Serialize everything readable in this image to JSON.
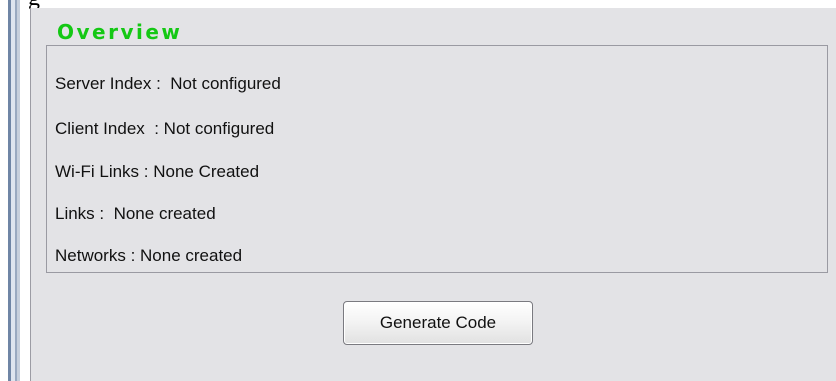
{
  "top_fragment": "g",
  "overview": {
    "title": "Overview",
    "lines": [
      "Server Index :  Not configured",
      "Client Index  : Not configured",
      "Wi-Fi Links : None Created",
      "Links :  None created",
      "Networks : None created"
    ]
  },
  "actions": {
    "generate_label": "Generate Code"
  },
  "colors": {
    "title_green": "#14c814",
    "panel_bg": "#e3e3e6"
  }
}
